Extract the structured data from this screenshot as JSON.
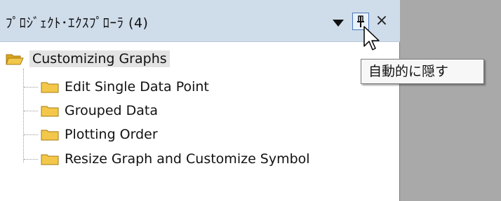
{
  "panel": {
    "title": "ﾌﾟﾛｼﾞｪｸﾄ･ｴｸｽﾌﾟﾛｰﾗ (4)",
    "dropdown_icon": "triangle-down-icon",
    "pin_icon": "pin-icon",
    "close_label": "×"
  },
  "tree": {
    "root": {
      "label": "Customizing Graphs",
      "icon": "open-folder-icon"
    },
    "children": [
      {
        "label": "Edit Single Data Point",
        "icon": "folder-icon"
      },
      {
        "label": "Grouped Data",
        "icon": "folder-icon"
      },
      {
        "label": "Plotting Order",
        "icon": "folder-icon"
      },
      {
        "label": "Resize Graph and Customize Symbol",
        "icon": "folder-icon"
      }
    ]
  },
  "tooltip": {
    "text": "自動的に隠す"
  },
  "colors": {
    "titlebar": "#cfdcea",
    "folder": "#f3c84a",
    "background": "#a9a9a9"
  }
}
